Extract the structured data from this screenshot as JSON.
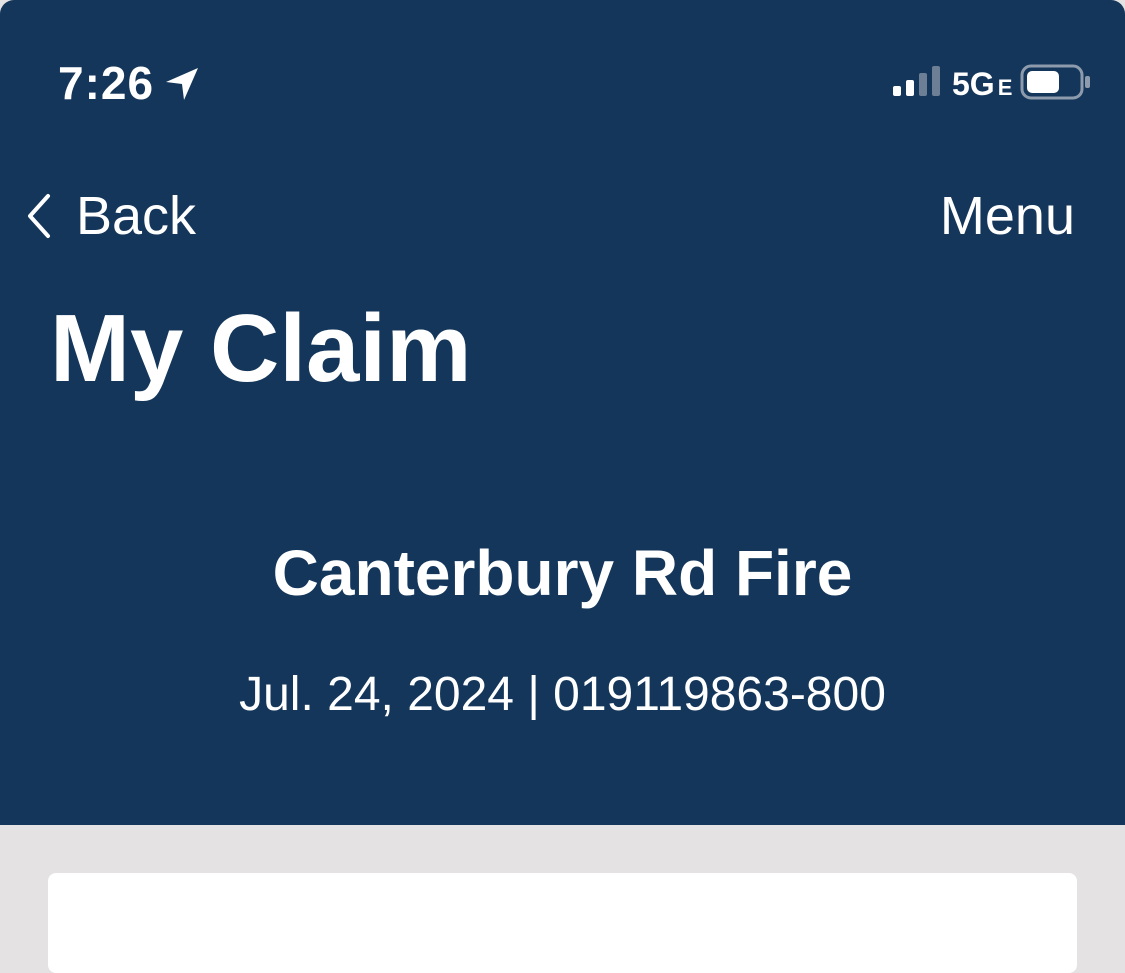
{
  "status_bar": {
    "time": "7:26",
    "network": "5G",
    "network_suffix": "E",
    "icons": [
      "location-arrow-icon",
      "signal-icon",
      "battery-icon"
    ]
  },
  "nav": {
    "back_label": "Back",
    "menu_label": "Menu"
  },
  "page": {
    "title": "My Claim"
  },
  "claim": {
    "name": "Canterbury Rd Fire",
    "meta": "Jul. 24, 2024 | 019119863-800"
  },
  "colors": {
    "header_bg": "#14365a",
    "page_bg": "#e4e2e3",
    "card_bg": "#ffffff",
    "text": "#ffffff"
  }
}
